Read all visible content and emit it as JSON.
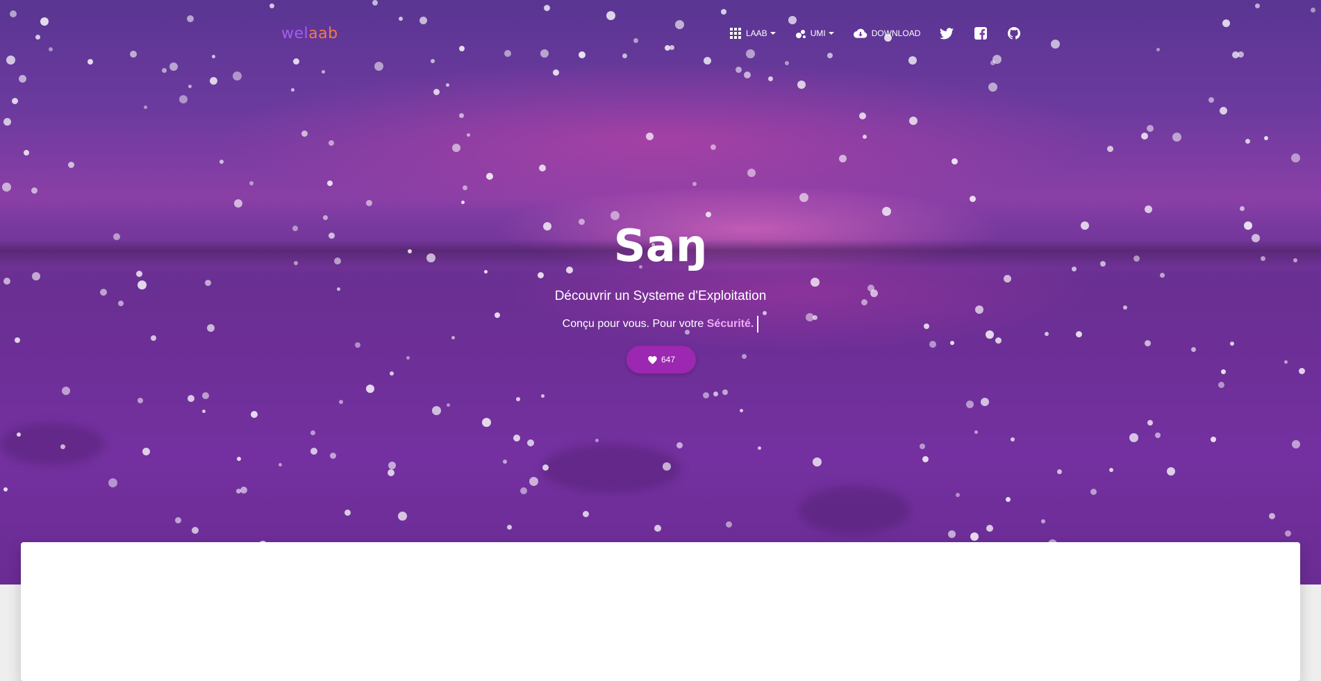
{
  "brand": {
    "part1": "wel",
    "part2": "aab"
  },
  "nav": {
    "items": [
      {
        "label": "LAAB",
        "icon": "apps-grid-icon",
        "dropdown": true
      },
      {
        "label": "UMI",
        "icon": "bubble-chart-icon",
        "dropdown": true
      },
      {
        "label": "DOWNLOAD",
        "icon": "cloud-download-icon",
        "dropdown": false
      }
    ],
    "social_icons": [
      "twitter-icon",
      "facebook-icon",
      "github-icon"
    ]
  },
  "hero": {
    "title": "Saŋ",
    "subtitle": "Découvrir un Systeme d'Exploitation",
    "tagline_prefix": "Conçu pour vous. Pour votre ",
    "tagline_highlight": "Sécurité."
  },
  "like_button": {
    "count": "647",
    "icon": "heart-icon"
  },
  "colors": {
    "accent": "#9c27b0",
    "brand_purple": "#a65cf0",
    "brand_orange": "#f07a4a",
    "highlight_pink": "#f3a9f5"
  }
}
